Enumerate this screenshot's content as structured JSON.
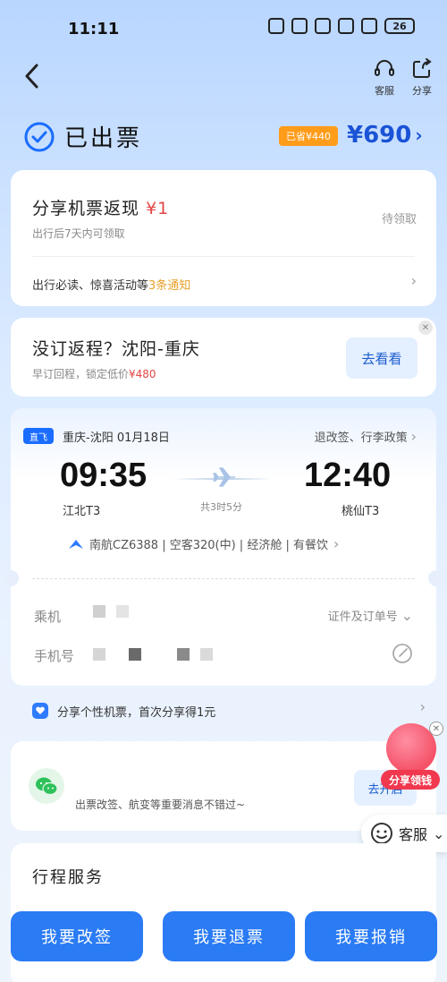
{
  "status_bar": {
    "time": "11:11",
    "battery": "26"
  },
  "header": {
    "service_label": "客服",
    "share_label": "分享"
  },
  "order": {
    "status": "已出票",
    "saved_badge": "已省¥440",
    "price": "¥690"
  },
  "cashback": {
    "title": "分享机票返现",
    "amount": "¥1",
    "subtitle": "出行后7天内可领取",
    "status": "待领取",
    "notice_prefix": "出行必读、惊喜活动等",
    "notice_highlight": "3条通知"
  },
  "return_trip": {
    "title": "没订返程？沈阳-重庆",
    "subtitle_prefix": "早订回程，锁定低价",
    "subtitle_amount": "¥480",
    "button": "去看看"
  },
  "flight": {
    "tag": "直飞",
    "route": "重庆-沈阳 01月18日",
    "policy": "退改签、行李政策",
    "dep_time": "09:35",
    "arr_time": "12:40",
    "duration": "共3时5分",
    "dep_airport": "江北T3",
    "arr_airport": "桃仙T3",
    "info": "南航CZ6388 | 空客320(中) | 经济舱 | 有餐饮"
  },
  "passenger": {
    "pax_label": "乘机",
    "docs_link": "证件及订单号",
    "phone_label": "手机号"
  },
  "share_strip": {
    "text": "分享个性机票，首次分享得1元"
  },
  "wechat": {
    "text": "出票改签、航变等重要消息不错过~",
    "button": "去开启"
  },
  "promo": {
    "label": "分享领钱"
  },
  "cs_float": {
    "label": "客服"
  },
  "itinerary": {
    "title": "行程服务"
  },
  "bottom": {
    "change": "我要改签",
    "refund": "我要退票",
    "reimburse": "我要报销"
  },
  "colors": {
    "accent": "#2a7bf4",
    "price": "#1a53d6",
    "badge": "#ff9c1a",
    "red": "#e24646",
    "promo": "#f0384f"
  }
}
